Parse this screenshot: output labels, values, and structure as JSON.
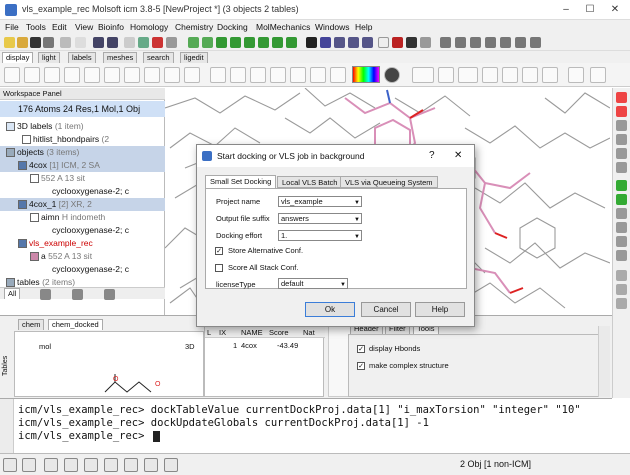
{
  "window": {
    "title": "vls_example_rec Molsoft icm 3.8-5 [NewProject *] (3 objects 2 tables)"
  },
  "menu": [
    "File",
    "Tools",
    "Edit",
    "View",
    "Bioinfo",
    "Homology",
    "Chemistry",
    "Docking",
    "MolMechanics",
    "Windows",
    "Help"
  ],
  "toolbar_tabs": [
    "display",
    "light",
    "labels",
    "meshes",
    "search",
    "ligedit"
  ],
  "workspace": {
    "title": "Workspace Panel",
    "summary": "176 Atoms 24 Res,1 Mol,1 Obj",
    "rows": [
      {
        "label": "3D labels",
        "extra": "(1 item)"
      },
      {
        "label": "hitlist_hbondpairs",
        "extra": "(2"
      },
      {
        "label": "objects",
        "extra": "(3 items)"
      },
      {
        "label": "4cox",
        "extra": "[1] ICM, 2 SA"
      },
      {
        "label": "552 A",
        "extra": "13 sit"
      },
      {
        "label": "cyclooxygenase-2; c",
        "extra": ""
      },
      {
        "label": "4cox_1",
        "extra": "[2] XR, 2"
      },
      {
        "label": "aimn",
        "extra": "H indometh"
      },
      {
        "label": "cyclooxygenase-2; c",
        "extra": ""
      },
      {
        "label": "vls_example_rec",
        "extra": ""
      },
      {
        "label": "a",
        "extra": "552 A 13 sit"
      },
      {
        "label": "cyclooxygenase-2; c",
        "extra": ""
      },
      {
        "label": "tables",
        "extra": "(2 items)"
      }
    ],
    "bottom_tab": "All"
  },
  "bottom": {
    "tabs": [
      "chem",
      "chem_docked"
    ],
    "mol_header": "mol",
    "mol_3d": "3D",
    "table_headers": [
      "L",
      "IX",
      "NAME",
      "Score",
      "Nat"
    ],
    "table_row": [
      "",
      "1",
      "4cox",
      "-43.49",
      ""
    ],
    "right_tabs": [
      "Header",
      "Filter",
      "Tools"
    ],
    "checks": [
      {
        "label": "display Hbonds",
        "checked": true
      },
      {
        "label": "make complex structure",
        "checked": true
      }
    ]
  },
  "console": {
    "lines": [
      "icm/vls_example_rec> dockTableValue currentDockProj.data[1] \"i_maxTorsion\" \"integer\" \"10\"",
      "icm/vls_example_rec> dockUpdateGlobals currentDockProj.data[1] -1",
      "icm/vls_example_rec> "
    ]
  },
  "status": {
    "text": "2 Obj [1 non-ICM]"
  },
  "dialog": {
    "title": "Start docking or VLS job in background",
    "help_glyph": "?",
    "close_glyph": "✕",
    "tabs": [
      "Small Set Docking",
      "Local VLS Batch",
      "VLS via Queueing System"
    ],
    "fields": [
      {
        "label": "Project name",
        "value": "vls_example"
      },
      {
        "label": "Output file suffix",
        "value": "answers"
      },
      {
        "label": "Docking effort",
        "value": "1."
      }
    ],
    "checks": [
      {
        "label": "Store Alternative Conf.",
        "checked": true
      },
      {
        "label": "Score All Stack Conf.",
        "checked": false
      }
    ],
    "license": {
      "label": "licenseType",
      "value": "default"
    },
    "buttons": {
      "ok": "Ok",
      "cancel": "Cancel",
      "help": "Help"
    }
  },
  "colors": {
    "selection": "#c6d4e8",
    "accent": "#3b6fc4",
    "highlight_red": "#cc0000"
  }
}
